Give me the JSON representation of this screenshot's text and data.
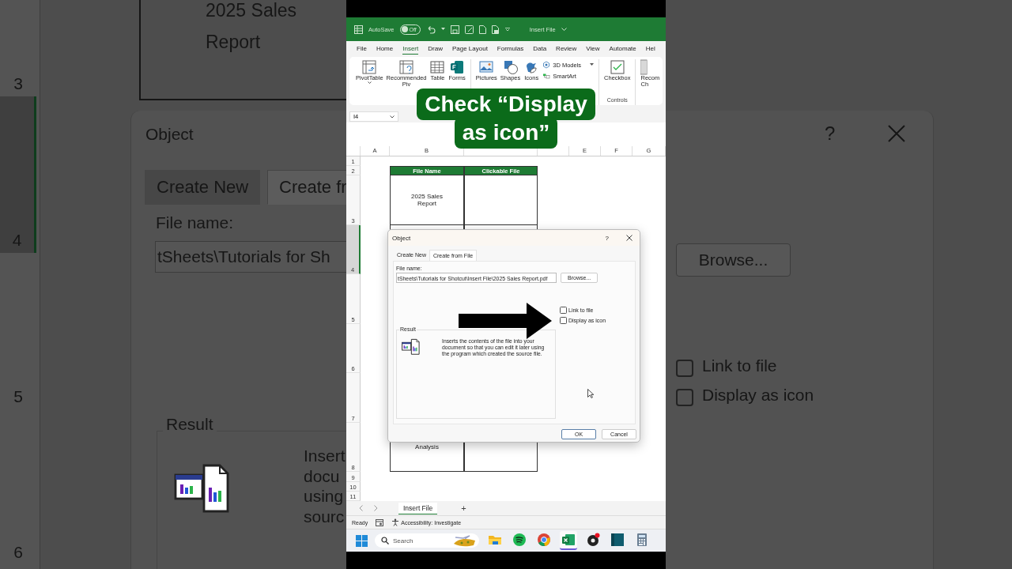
{
  "backdrop_left": {
    "row_numbers": [
      {
        "label": "3",
        "selected": false
      },
      {
        "label": "4",
        "selected": true
      },
      {
        "label": "5",
        "selected": false
      },
      {
        "label": "6",
        "selected": false
      }
    ],
    "cell_lines": [
      "2025 Sales",
      "Report"
    ],
    "dialog": {
      "title": "Object",
      "tabs": [
        {
          "label": "Create New",
          "selected": false
        },
        {
          "label": "Create fr",
          "selected": true
        }
      ],
      "file_name_label": "File name:",
      "file_name_value": "tSheets\\Tutorials for Sh",
      "result_label": "Result",
      "description_lines": [
        "Insert",
        "docu",
        "using",
        "sourc"
      ]
    }
  },
  "title_bar": {
    "autosave_label": "AutoSave",
    "autosave": {
      "label": "Off",
      "on": false
    },
    "document_title": "Insert File"
  },
  "menu_tabs": [
    {
      "label": "File",
      "selected": false
    },
    {
      "label": "Home",
      "selected": false
    },
    {
      "label": "Insert",
      "selected": true
    },
    {
      "label": "Draw",
      "selected": false
    },
    {
      "label": "Page Layout",
      "selected": false
    },
    {
      "label": "Formulas",
      "selected": false
    },
    {
      "label": "Data",
      "selected": false
    },
    {
      "label": "Review",
      "selected": false
    },
    {
      "label": "View",
      "selected": false
    },
    {
      "label": "Automate",
      "selected": false
    },
    {
      "label": "Hel",
      "selected": false
    }
  ],
  "ribbon": {
    "groups": [
      {
        "items": [
          {
            "kind": "pivot",
            "lines": [
              "PivotTable"
            ]
          },
          {
            "kind": "recommended",
            "lines": [
              "Recommended",
              "Piv"
            ]
          },
          {
            "kind": "table",
            "lines": [
              "Table"
            ]
          },
          {
            "kind": "forms",
            "lines": [
              "Forms"
            ]
          }
        ]
      },
      {
        "items": [
          {
            "kind": "pictures",
            "lines": [
              "Pictures"
            ]
          },
          {
            "kind": "shapes",
            "lines": [
              "Shapes"
            ]
          },
          {
            "kind": "icons",
            "lines": [
              "Icons"
            ]
          },
          {
            "kind": "models",
            "lines": [
              "3D Models"
            ]
          },
          {
            "kind": "smartart",
            "lines": [
              "SmartArt"
            ]
          }
        ]
      },
      {
        "label": "Controls",
        "items": [
          {
            "kind": "checkbox",
            "lines": [
              "Checkbox"
            ]
          }
        ]
      },
      {
        "items": [
          {
            "kind": "charts",
            "lines": [
              "Recom",
              "Ch"
            ]
          }
        ]
      }
    ]
  },
  "caption_lines": [
    "Check “Display",
    "as icon”"
  ],
  "formula_bar": {
    "name_box": "I4"
  },
  "column_headers": [
    "A",
    "B",
    "E",
    "F",
    "G"
  ],
  "rows": [
    {
      "number": "1",
      "kind": "blank",
      "selected": false
    },
    {
      "number": "2",
      "kind": "header",
      "selected": false,
      "cells": [
        "File Name",
        "Clickable File"
      ]
    },
    {
      "number": "3",
      "kind": "entry",
      "selected": false,
      "file_name": "2025 Sales Report"
    },
    {
      "number": "4",
      "kind": "entry",
      "selected": true
    },
    {
      "number": "5",
      "kind": "entry",
      "selected": false
    },
    {
      "number": "6",
      "kind": "entry",
      "selected": false
    },
    {
      "number": "7",
      "kind": "entry",
      "selected": false
    },
    {
      "number": "8",
      "kind": "entry",
      "selected": false,
      "file_name": "Analysis"
    },
    {
      "number": "9",
      "kind": "blank",
      "selected": false
    },
    {
      "number": "10",
      "kind": "blank",
      "selected": false
    },
    {
      "number": "11",
      "kind": "blank",
      "selected": false
    }
  ],
  "dialog": {
    "title": "Object",
    "help": "?",
    "tabs": [
      {
        "label": "Create New",
        "selected": false
      },
      {
        "label": "Create from File",
        "selected": true
      }
    ],
    "file_name_label": "File name:",
    "file_name_value": "tSheets\\Tutorials for Shotcut\\Insert File\\2025 Sales Report.pdf",
    "browse": "Browse...",
    "options": [
      {
        "label": "Link to file",
        "checked": false
      },
      {
        "label": "Display as icon",
        "checked": false
      }
    ],
    "result_label": "Result",
    "result_text": "Inserts the contents of the file into your document so that you can edit it later using the program which created the source file.",
    "buttons": [
      {
        "label": "OK",
        "kind": "default"
      },
      {
        "label": "Cancel",
        "kind": "normal"
      }
    ]
  },
  "sheet_tabs": [
    {
      "label": "Insert File",
      "selected": true
    }
  ],
  "add_sheet": "+",
  "status_bar": {
    "ready": "Ready",
    "accessibility": "Accessibility: Investigate"
  },
  "taskbar": {
    "search_placeholder": "Search",
    "apps": [
      {
        "kind": "folder",
        "selected": false
      },
      {
        "kind": "music",
        "selected": false
      },
      {
        "kind": "browser",
        "selected": false
      },
      {
        "kind": "spreadsheet",
        "selected": true
      },
      {
        "kind": "recorder",
        "selected": false
      },
      {
        "kind": "tile",
        "selected": false
      },
      {
        "kind": "calculator",
        "selected": false
      }
    ]
  },
  "backdrop_right": {
    "help": "?",
    "browse": "Browse...",
    "options": [
      {
        "label": "Link to file",
        "checked": false
      },
      {
        "label": "Display as icon",
        "checked": false
      }
    ]
  }
}
